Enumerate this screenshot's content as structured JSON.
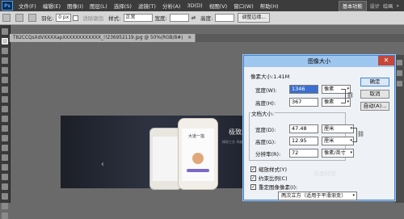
{
  "menubar": {
    "logo": "Ps",
    "items": [
      "文件(F)",
      "编辑(E)",
      "图像(I)",
      "图层(L)",
      "选择(S)",
      "滤镜(T)",
      "分析(A)",
      "3D(D)",
      "视图(V)",
      "窗口(W)",
      "帮助(H)"
    ],
    "workspace": "基本功能",
    "design": "设计",
    "painting": "绘画",
    "more": "»"
  },
  "options": {
    "feather_label": "羽化:",
    "feather_value": "0 px",
    "antialias_label": "消除锯齿",
    "style_label": "样式:",
    "style_value": "正常",
    "width_label": "宽度:",
    "height_label": "高度:",
    "refine_button": "调整边缘..."
  },
  "tab": {
    "title": "T82CCQsXdVXXXXapXXXXXXXXXXXX_!!236952119.jpg @ 50%(RGB/8#)",
    "close": "×"
  },
  "photo": {
    "headline": "极致简约 |",
    "subline": "精致工艺 卓越设计",
    "caption": "大道一指",
    "prev_arrow": "‹"
  },
  "dialog": {
    "title": "图像大小",
    "close": "✕",
    "pixel_dims": "像素大小:1.41M",
    "width_label": "宽度(W):",
    "width_value": "1346",
    "width_unit": "像素",
    "height_label": "高度(H):",
    "height_value": "367",
    "height_unit": "像素",
    "doc_size_label": "文档大小:",
    "doc_width_label": "宽度(D):",
    "doc_width_value": "47.48",
    "doc_width_unit": "厘米",
    "doc_height_label": "高度(G):",
    "doc_height_value": "12.95",
    "doc_height_unit": "厘米",
    "resolution_label": "分辨率(R):",
    "resolution_value": "72",
    "resolution_unit": "像素/英寸",
    "ok": "确定",
    "cancel": "取消",
    "auto": "自动(A)...",
    "scale_styles": "缩放样式(Y)",
    "constrain": "约束比例(C)",
    "resample": "重定图像像素(I):",
    "resample_method": "两次立方（适用于平滑渐变）",
    "dropdown_arrow": "▾",
    "check_mark": "✓"
  },
  "watermark": "百度经验"
}
